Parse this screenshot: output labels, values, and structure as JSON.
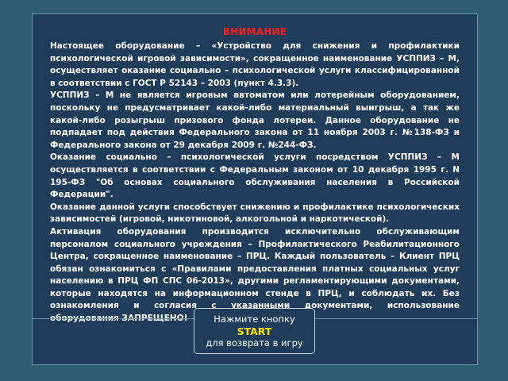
{
  "notice": {
    "title": "ВНИМАНИЕ",
    "paragraphs": [
      "Настоящее оборудование – «Устройство для снижения и профилактики психологической игровой зависимости», сокращенное наименование УСППИЗ – М, осуществляет оказание социально – психологической услуги классифицированной в соответствии с ГОСТ Р 52143 – 2003 (пункт 4.3.3).",
      "УСППИЗ – М не является игровым автоматом или лотерейным оборудованием, поскольку не предусматривает какой-либо материальный выигрыш, а так же какой-либо розыгрыш призового фонда лотереи. Данное оборудование не подпадает под действия Федерального закона от 11 ноября 2003 г. №138-ФЗ и Федерального закона от 29 декабря 2009 г. №244-ФЗ.",
      "Оказание социально – психологической услуги посредством УСППИЗ – М осуществляется в соответствии с Федеральным законом от 10 декабря 1995 г. N 195-ФЗ \"Об основах социального обслуживания населения в Российской Федерации\".",
      "Оказание данной услуги способствует снижению и профилактике психологических зависимостей (игровой, никотиновой, алкогольной и наркотической).",
      "Активация оборудования производится исключительно обслуживающим персоналом социального учреждения – Профилактического Реабилитационного Центра, сокращенное наименование – ПРЦ. Каждый пользователь – Клиент ПРЦ обязан ознакомиться с «Правилами предоставления платных социальных услуг населению в ПРЦ ФП СПС 06-2013», другими регламентирующими документами, которые находятся на информационном стенде в ПРЦ, и соблюдать их. Без ознакомления и согласия с указанными документами, использование оборудования ЗАПРЕЩЕНО!"
    ]
  },
  "start_button": {
    "line1": "Нажмите кнопку",
    "line2": "START",
    "line3": "для возврата в игру"
  },
  "colors": {
    "background": "#2e5c70",
    "panel": "#1f3d5a",
    "title": "#ff1f1f",
    "start_label": "#ffe400",
    "text": "#ffffff"
  }
}
